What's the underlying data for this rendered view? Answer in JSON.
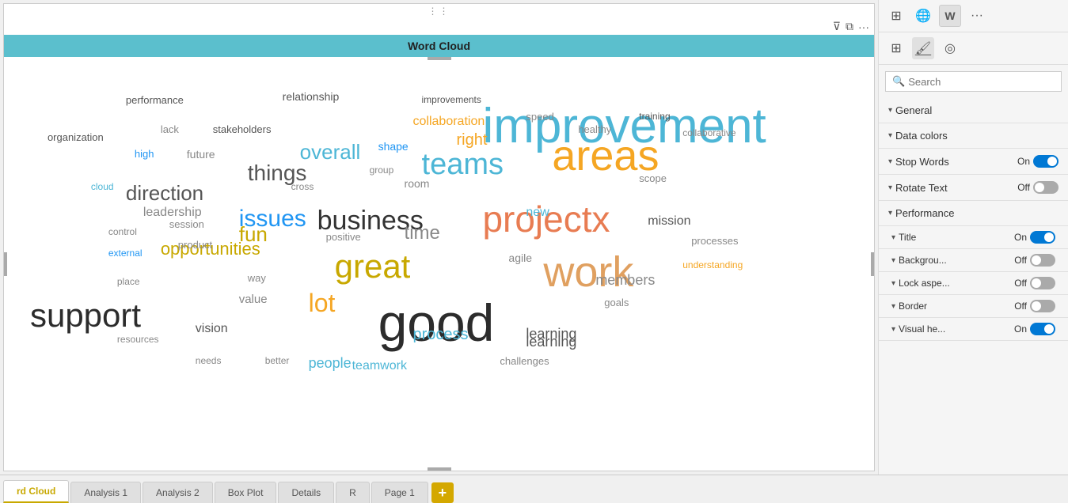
{
  "wordcloud": {
    "title": "Word Cloud",
    "words": [
      {
        "text": "improvement",
        "size": 62,
        "color": "#4db6d6",
        "left": "55",
        "top": "10"
      },
      {
        "text": "areas",
        "size": 54,
        "color": "#f5a623",
        "left": "63",
        "top": "18"
      },
      {
        "text": "projectx",
        "size": 46,
        "color": "#e87c52",
        "left": "55",
        "top": "34"
      },
      {
        "text": "good",
        "size": 66,
        "color": "#2c2c2c",
        "left": "43",
        "top": "57"
      },
      {
        "text": "work",
        "size": 54,
        "color": "#e0a060",
        "left": "62",
        "top": "46"
      },
      {
        "text": "great",
        "size": 42,
        "color": "#c8a800",
        "left": "38",
        "top": "46"
      },
      {
        "text": "support",
        "size": 42,
        "color": "#2c2c2c",
        "left": "3",
        "top": "58"
      },
      {
        "text": "teams",
        "size": 38,
        "color": "#4db6d6",
        "left": "48",
        "top": "22"
      },
      {
        "text": "business",
        "size": 34,
        "color": "#333",
        "left": "36",
        "top": "36"
      },
      {
        "text": "issues",
        "size": 30,
        "color": "#2196f3",
        "left": "27",
        "top": "36"
      },
      {
        "text": "things",
        "size": 28,
        "color": "#555",
        "left": "28",
        "top": "25"
      },
      {
        "text": "direction",
        "size": 26,
        "color": "#555",
        "left": "14",
        "top": "30"
      },
      {
        "text": "overall",
        "size": 26,
        "color": "#4db6d6",
        "left": "34",
        "top": "20"
      },
      {
        "text": "opportunities",
        "size": 22,
        "color": "#c8a800",
        "left": "18",
        "top": "44"
      },
      {
        "text": "time",
        "size": 24,
        "color": "#888",
        "left": "46",
        "top": "40"
      },
      {
        "text": "fun",
        "size": 26,
        "color": "#c8a800",
        "left": "27",
        "top": "40"
      },
      {
        "text": "lot",
        "size": 32,
        "color": "#f5a623",
        "left": "35",
        "top": "56"
      },
      {
        "text": "process",
        "size": 20,
        "color": "#4db6d6",
        "left": "47",
        "top": "65"
      },
      {
        "text": "people",
        "size": 18,
        "color": "#4db6d6",
        "left": "35",
        "top": "72"
      },
      {
        "text": "learning",
        "size": 18,
        "color": "#555",
        "left": "60",
        "top": "67"
      },
      {
        "text": "members",
        "size": 18,
        "color": "#888",
        "left": "68",
        "top": "52"
      },
      {
        "text": "mission",
        "size": 16,
        "color": "#555",
        "left": "74",
        "top": "38"
      },
      {
        "text": "collaboration",
        "size": 16,
        "color": "#f5a623",
        "left": "47",
        "top": "14"
      },
      {
        "text": "new",
        "size": 16,
        "color": "#4db6d6",
        "left": "60",
        "top": "36"
      },
      {
        "text": "agile",
        "size": 14,
        "color": "#888",
        "left": "58",
        "top": "47"
      },
      {
        "text": "goals",
        "size": 13,
        "color": "#888",
        "left": "69",
        "top": "58"
      },
      {
        "text": "performance",
        "size": 13,
        "color": "#555",
        "left": "14",
        "top": "9"
      },
      {
        "text": "relationship",
        "size": 14,
        "color": "#555",
        "left": "32",
        "top": "8"
      },
      {
        "text": "improvements",
        "size": 12,
        "color": "#555",
        "left": "48",
        "top": "9"
      },
      {
        "text": "right",
        "size": 20,
        "color": "#f5a623",
        "left": "52",
        "top": "18"
      },
      {
        "text": "high",
        "size": 13,
        "color": "#2196f3",
        "left": "15",
        "top": "22"
      },
      {
        "text": "shape",
        "size": 14,
        "color": "#2196f3",
        "left": "43",
        "top": "20"
      },
      {
        "text": "future",
        "size": 14,
        "color": "#888",
        "left": "21",
        "top": "22"
      },
      {
        "text": "organization",
        "size": 13,
        "color": "#555",
        "left": "5",
        "top": "18"
      },
      {
        "text": "lack",
        "size": 13,
        "color": "#888",
        "left": "18",
        "top": "16"
      },
      {
        "text": "stakeholders",
        "size": 13,
        "color": "#555",
        "left": "24",
        "top": "16"
      },
      {
        "text": "scope",
        "size": 13,
        "color": "#888",
        "left": "73",
        "top": "28"
      },
      {
        "text": "healthy",
        "size": 13,
        "color": "#888",
        "left": "66",
        "top": "16"
      },
      {
        "text": "speed",
        "size": 13,
        "color": "#888",
        "left": "60",
        "top": "13"
      },
      {
        "text": "training",
        "size": 12,
        "color": "#555",
        "left": "73",
        "top": "13"
      },
      {
        "text": "collaborative",
        "size": 12,
        "color": "#888",
        "left": "78",
        "top": "17"
      },
      {
        "text": "cloud",
        "size": 12,
        "color": "#4db6d6",
        "left": "10",
        "top": "30"
      },
      {
        "text": "leadership",
        "size": 16,
        "color": "#888",
        "left": "16",
        "top": "36"
      },
      {
        "text": "group",
        "size": 12,
        "color": "#888",
        "left": "42",
        "top": "26"
      },
      {
        "text": "room",
        "size": 14,
        "color": "#888",
        "left": "46",
        "top": "29"
      },
      {
        "text": "cross",
        "size": 12,
        "color": "#888",
        "left": "33",
        "top": "30"
      },
      {
        "text": "session",
        "size": 13,
        "color": "#888",
        "left": "19",
        "top": "39"
      },
      {
        "text": "control",
        "size": 12,
        "color": "#888",
        "left": "12",
        "top": "41"
      },
      {
        "text": "external",
        "size": 12,
        "color": "#2196f3",
        "left": "12",
        "top": "46"
      },
      {
        "text": "product",
        "size": 13,
        "color": "#888",
        "left": "20",
        "top": "44"
      },
      {
        "text": "positive",
        "size": 13,
        "color": "#888",
        "left": "37",
        "top": "42"
      },
      {
        "text": "processes",
        "size": 13,
        "color": "#888",
        "left": "79",
        "top": "43"
      },
      {
        "text": "understanding",
        "size": 12,
        "color": "#f5a623",
        "left": "78",
        "top": "49"
      },
      {
        "text": "way",
        "size": 13,
        "color": "#888",
        "left": "28",
        "top": "52"
      },
      {
        "text": "place",
        "size": 12,
        "color": "#888",
        "left": "13",
        "top": "53"
      },
      {
        "text": "value",
        "size": 15,
        "color": "#888",
        "left": "27",
        "top": "57"
      },
      {
        "text": "vision",
        "size": 16,
        "color": "#555",
        "left": "22",
        "top": "64"
      },
      {
        "text": "resources",
        "size": 12,
        "color": "#888",
        "left": "13",
        "top": "67"
      },
      {
        "text": "needs",
        "size": 12,
        "color": "#888",
        "left": "22",
        "top": "72"
      },
      {
        "text": "better",
        "size": 12,
        "color": "#888",
        "left": "30",
        "top": "72"
      },
      {
        "text": "teamwork",
        "size": 16,
        "color": "#4db6d6",
        "left": "40",
        "top": "73"
      },
      {
        "text": "challenges",
        "size": 13,
        "color": "#888",
        "left": "57",
        "top": "72"
      },
      {
        "text": "learning",
        "size": 18,
        "color": "#555",
        "left": "60",
        "top": "65"
      }
    ]
  },
  "tabs": [
    {
      "label": "rd Cloud",
      "active": true
    },
    {
      "label": "Analysis 1",
      "active": false
    },
    {
      "label": "Analysis 2",
      "active": false
    },
    {
      "label": "Box Plot",
      "active": false
    },
    {
      "label": "Details",
      "active": false
    },
    {
      "label": "R",
      "active": false
    },
    {
      "label": "Page 1",
      "active": false
    }
  ],
  "rightPanel": {
    "searchPlaceholder": "Search",
    "sections": [
      {
        "label": "General",
        "expanded": true
      },
      {
        "label": "Data colors",
        "expanded": true
      },
      {
        "label": "Stop Words",
        "expanded": true,
        "toggleLabel": "On",
        "toggleOn": true
      },
      {
        "label": "Rotate Text",
        "expanded": true,
        "toggleLabel": "Off",
        "toggleOn": false
      },
      {
        "label": "Performance",
        "expanded": true
      },
      {
        "label": "Title",
        "indent": true,
        "toggleLabel": "On",
        "toggleOn": true
      },
      {
        "label": "Backgrou...",
        "indent": true,
        "toggleLabel": "Off",
        "toggleOn": false
      },
      {
        "label": "Lock aspe...",
        "indent": true,
        "toggleLabel": "Off",
        "toggleOn": false
      },
      {
        "label": "Border",
        "indent": true,
        "toggleLabel": "Off",
        "toggleOn": false
      },
      {
        "label": "Visual he...",
        "expanded": true,
        "toggleLabel": "On",
        "toggleOn": true
      }
    ]
  }
}
